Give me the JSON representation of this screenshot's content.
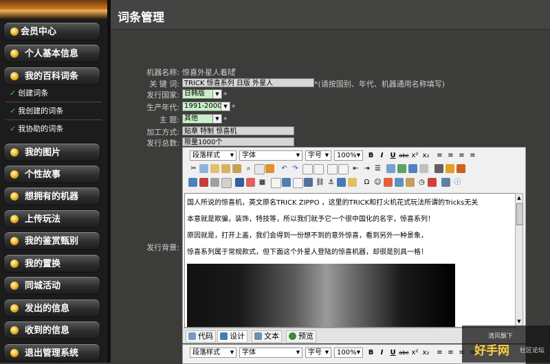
{
  "sidebar": {
    "items": [
      {
        "label": "会员中心"
      },
      {
        "label": "个人基本信息"
      },
      {
        "label": "我的百科词条"
      },
      {
        "label": "我的图片"
      },
      {
        "label": "个性故事"
      },
      {
        "label": "想拥有的机器"
      },
      {
        "label": "上传玩法"
      },
      {
        "label": "我的鉴赏甄别"
      },
      {
        "label": "我的置换"
      },
      {
        "label": "同城活动"
      },
      {
        "label": "发出的信息"
      },
      {
        "label": "收到的信息"
      },
      {
        "label": "退出管理系统"
      }
    ],
    "sub_items": [
      {
        "label": "创建词条"
      },
      {
        "label": "我创建的词条"
      },
      {
        "label": "我协助的词条"
      }
    ]
  },
  "main": {
    "title": "词条管理",
    "form": {
      "machine_name_label": "机器名称:",
      "machine_name_value": "惊喜外星人着陆",
      "required_mark": "*",
      "keywords_label": "关 键 词:",
      "keywords_value": "TRICK 惊喜系列 日版 外星人",
      "keywords_hint": "*(请按国别、年代、机器通用名称填写)",
      "country_label": "发行国家:",
      "country_value": "日韩版",
      "year_label": "生产年代:",
      "year_value": "1991-2000",
      "theme_label": "主 题:",
      "theme_value": "其他",
      "process_label": "加工方式:",
      "process_value": "贴章 特制 惊喜机",
      "total_label": "发行总数:",
      "total_value": "限量1000个",
      "background_label": "发行背景:"
    },
    "editor": {
      "paragraph_style": "段落样式",
      "font": "字体",
      "font_size": "字号",
      "zoom": "100%",
      "content": [
        "国人所说的惊喜机，英文原名TRICK ZIPPO ，这里的TRICK和打火机花式玩法所谓的Tricks无关",
        "本意就是欺骗，装饰，特技等，所以我们就予它一个很中国化的名字，惊喜系列！",
        "原因就是，打开上盖，我们会得到一份想不到的意外惊喜，看到另外一种景象，",
        "惊喜系列属于常规款式，但下面这个外星人登陆的惊喜机器，却很是别具一格！"
      ],
      "modes": {
        "code": "代码",
        "design": "设计",
        "text": "文本",
        "preview": "预览"
      }
    }
  },
  "watermark": {
    "top": "清风飘下",
    "main": "好手网",
    "sub": "社区论坛"
  },
  "colors": {
    "sidebar_bg": "#1c1c1c",
    "main_bg": "#3c3c3a",
    "bullet": "#f0c030",
    "check": "#3fd13f"
  }
}
